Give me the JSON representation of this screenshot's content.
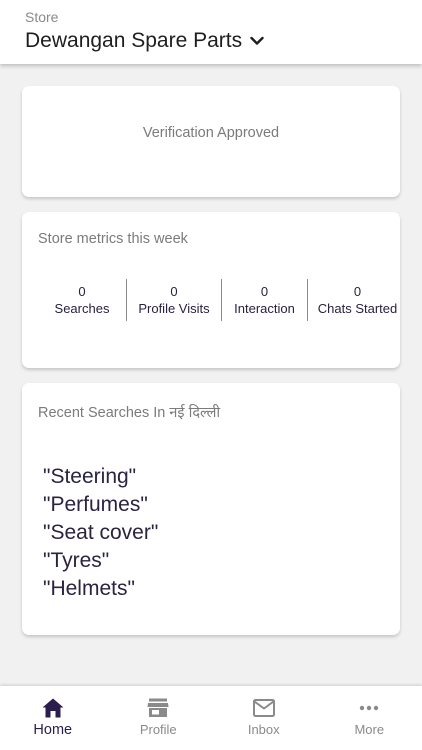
{
  "header": {
    "store_label": "Store",
    "store_name": "Dewangan Spare Parts"
  },
  "verification": {
    "status_text": "Verification Approved"
  },
  "metrics": {
    "title": "Store metrics this week",
    "items": [
      {
        "value": "0",
        "label": "Searches"
      },
      {
        "value": "0",
        "label": "Profile Visits"
      },
      {
        "value": "0",
        "label": "Interaction"
      },
      {
        "value": "0",
        "label": "Chats Started"
      }
    ]
  },
  "recent_searches": {
    "title": "Recent Searches In नई दिल्ली",
    "items": [
      "\"Steering\"",
      "\"Perfumes\"",
      "\"Seat cover\"",
      "\"Tyres\"",
      "\"Helmets\""
    ]
  },
  "bottom_nav": {
    "items": [
      {
        "label": "Home",
        "icon": "home-icon",
        "active": true
      },
      {
        "label": "Profile",
        "icon": "store-icon",
        "active": false
      },
      {
        "label": "Inbox",
        "icon": "mail-icon",
        "active": false
      },
      {
        "label": "More",
        "icon": "more-horizontal-icon",
        "active": false
      }
    ]
  },
  "colors": {
    "accent": "#2b1d4d",
    "inactive": "#8a8a8a",
    "background": "#f1f1f1",
    "card": "#ffffff"
  }
}
